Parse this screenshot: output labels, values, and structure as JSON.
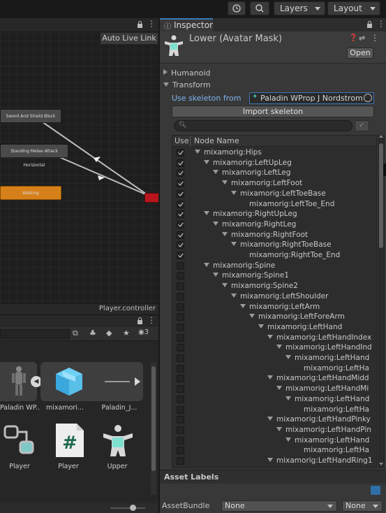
{
  "toolbar": {
    "layers_label": "Layers",
    "layout_label": "Layout"
  },
  "animator": {
    "auto_live_link": "Auto Live Link",
    "states": [
      {
        "label": "Sword And Shield Block"
      },
      {
        "label": "Standing Melee Attack Horizontal"
      },
      {
        "label": "Walking"
      }
    ],
    "controller_name": "Player.controller"
  },
  "project": {
    "hidden_count": "3",
    "assets": [
      {
        "label": "Paladin WP..."
      },
      {
        "label": "mixamori..."
      },
      {
        "label": "Paladin_J..."
      },
      {
        "label": "Player"
      },
      {
        "label": "Player"
      },
      {
        "label": "Upper"
      }
    ]
  },
  "inspector": {
    "tab_label": "Inspector",
    "asset_title": "Lower (Avatar Mask)",
    "open_button": "Open",
    "humanoid_label": "Humanoid",
    "transform_label": "Transform",
    "use_skeleton_label": "Use skeleton from",
    "skeleton_value": "Paladin WProp J Nordstrom",
    "import_button": "Import skeleton",
    "search_value": "",
    "col_use": "Use",
    "col_node": "Node Name",
    "nodes": [
      {
        "name": "mixamorig:Hips",
        "checked": true
      },
      {
        "name": "mixamorig:LeftUpLeg",
        "checked": true
      },
      {
        "name": "mixamorig:LeftLeg",
        "checked": true
      },
      {
        "name": "mixamorig:LeftFoot",
        "checked": true
      },
      {
        "name": "mixamorig:LeftToeBase",
        "checked": true
      },
      {
        "name": "mixamorig:LeftToe_End",
        "checked": true
      },
      {
        "name": "mixamorig:RightUpLeg",
        "checked": true
      },
      {
        "name": "mixamorig:RightLeg",
        "checked": true
      },
      {
        "name": "mixamorig:RightFoot",
        "checked": true
      },
      {
        "name": "mixamorig:RightToeBase",
        "checked": true
      },
      {
        "name": "mixamorig:RightToe_End",
        "checked": true
      },
      {
        "name": "mixamorig:Spine",
        "checked": false
      },
      {
        "name": "mixamorig:Spine1",
        "checked": false
      },
      {
        "name": "mixamorig:Spine2",
        "checked": false
      },
      {
        "name": "mixamorig:LeftShoulder",
        "checked": false
      },
      {
        "name": "mixamorig:LeftArm",
        "checked": false
      },
      {
        "name": "mixamorig:LeftForeArm",
        "checked": false
      },
      {
        "name": "mixamorig:LeftHand",
        "checked": false
      },
      {
        "name": "mixamorig:LeftHandIndex",
        "checked": false
      },
      {
        "name": "mixamorig:LeftHandInd",
        "checked": false
      },
      {
        "name": "mixamorig:LeftHand",
        "checked": false
      },
      {
        "name": "mixamorig:LeftHa",
        "checked": false
      },
      {
        "name": "mixamorig:LeftHandMidd",
        "checked": false
      },
      {
        "name": "mixamorig:LeftHandMi",
        "checked": false
      },
      {
        "name": "mixamorig:LeftHand",
        "checked": false
      },
      {
        "name": "mixamorig:LeftHa",
        "checked": false
      },
      {
        "name": "mixamorig:LeftHandPinky",
        "checked": false
      },
      {
        "name": "mixamorig:LeftHandPin",
        "checked": false
      },
      {
        "name": "mixamorig:LeftHand",
        "checked": false
      },
      {
        "name": "mixamorig:LeftHa",
        "checked": false
      },
      {
        "name": "mixamorig:LeftHandRing1",
        "checked": false
      }
    ],
    "asset_labels": "Asset Labels",
    "asset_bundle_label": "AssetBundle",
    "asset_bundle_value": "None",
    "asset_bundle_variant": "None"
  },
  "colors": {
    "accent": "#3a79bb",
    "walking_state": "#d6801a",
    "selected_state": "#b8161c",
    "link_text": "#7eb6f0"
  }
}
